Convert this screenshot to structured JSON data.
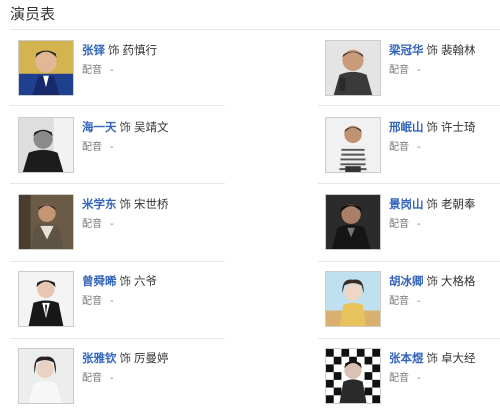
{
  "section": {
    "title": "演员表"
  },
  "cast": [
    {
      "actor": "张铎",
      "as": "饰",
      "role": "药慎行",
      "dub_label": "配音",
      "dub_value": "-"
    },
    {
      "actor": "梁冠华",
      "as": "饰",
      "role": "裴翰林",
      "dub_label": "配音",
      "dub_value": "-"
    },
    {
      "actor": "海一天",
      "as": "饰",
      "role": "吴靖文",
      "dub_label": "配音",
      "dub_value": "-"
    },
    {
      "actor": "邢岷山",
      "as": "饰",
      "role": "许士琦",
      "dub_label": "配音",
      "dub_value": "-"
    },
    {
      "actor": "米学东",
      "as": "饰",
      "role": "宋世桥",
      "dub_label": "配音",
      "dub_value": "-"
    },
    {
      "actor": "景岗山",
      "as": "饰",
      "role": "老朝奉",
      "dub_label": "配音",
      "dub_value": "-"
    },
    {
      "actor": "曾舜晞",
      "as": "饰",
      "role": "六爷",
      "dub_label": "配音",
      "dub_value": "-"
    },
    {
      "actor": "胡冰卿",
      "as": "饰",
      "role": "大格格",
      "dub_label": "配音",
      "dub_value": "-"
    },
    {
      "actor": "张雅钦",
      "as": "饰",
      "role": "厉曼婷",
      "dub_label": "配音",
      "dub_value": "-"
    },
    {
      "actor": "张本煜",
      "as": "饰",
      "role": "卓大经",
      "dub_label": "配音",
      "dub_value": "-"
    }
  ],
  "colors": {
    "actor_link": "#3366bb",
    "divider": "#e8e8e8"
  }
}
